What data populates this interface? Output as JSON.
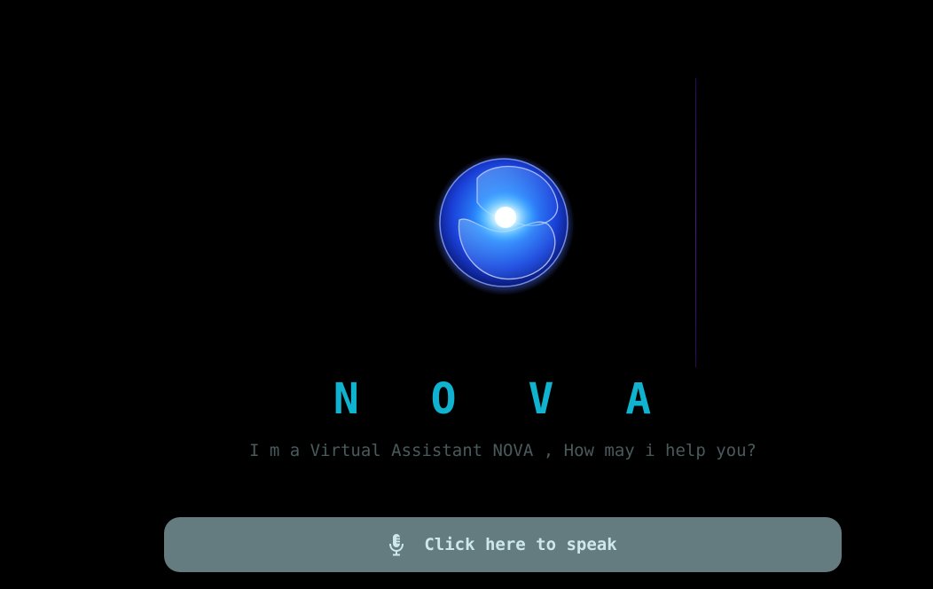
{
  "app": {
    "title": "N O V A",
    "subtitle": "I m a Virtual Assistant NOVA , How may i help you?"
  },
  "speak_button": {
    "label": "Click here to speak",
    "icon": "microphone-icon"
  },
  "colors": {
    "background": "#000000",
    "title": "#0fb3cf",
    "subtitle": "#4a5a5c",
    "button_bg": "#647c7f",
    "button_text": "#cde8ec"
  }
}
